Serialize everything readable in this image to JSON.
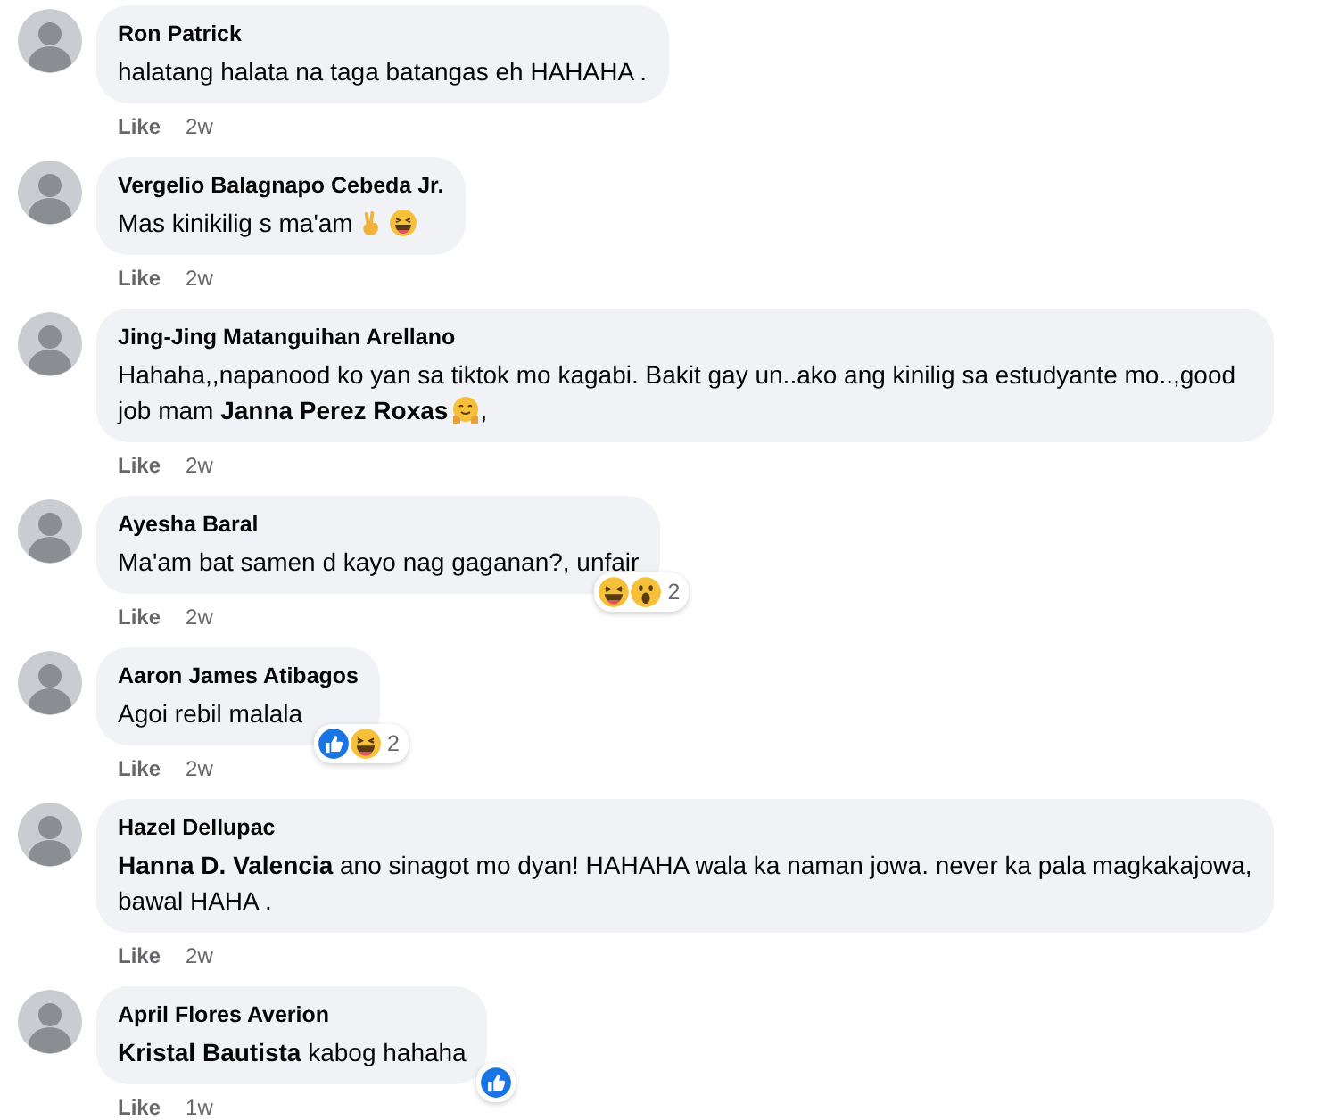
{
  "comments": [
    {
      "author": "Ron Patrick",
      "body": [
        {
          "kind": "text",
          "text": "halatang halata na taga batangas eh HAHAHA ."
        }
      ],
      "like": "Like",
      "time": "2w"
    },
    {
      "author": "Vergelio Balagnapo Cebeda Jr.",
      "body": [
        {
          "kind": "text",
          "text": "Mas kinikilig s ma'am"
        },
        {
          "kind": "peace"
        },
        {
          "kind": "laugh"
        }
      ],
      "like": "Like",
      "time": "2w"
    },
    {
      "author": "Jing-Jing Matanguihan Arellano",
      "body": [
        {
          "kind": "text",
          "text": "Hahaha,,napanood ko yan sa tiktok mo kagabi. Bakit gay un..ako ang kinilig sa estudyante mo..,good job mam "
        },
        {
          "kind": "mention",
          "text": "Janna Perez Roxas"
        },
        {
          "kind": "hug"
        },
        {
          "kind": "text",
          "text": ","
        }
      ],
      "like": "Like",
      "time": "2w"
    },
    {
      "author": "Ayesha Baral",
      "body": [
        {
          "kind": "text",
          "text": "Ma'am bat samen d kayo nag gaganan?, unfair"
        }
      ],
      "like": "Like",
      "time": "2w",
      "reactions": {
        "types": [
          {
            "kind": "haha"
          },
          {
            "kind": "wow"
          }
        ],
        "count": "2"
      }
    },
    {
      "author": "Aaron James Atibagos",
      "body": [
        {
          "kind": "text",
          "text": "Agoi rebil malala"
        }
      ],
      "like": "Like",
      "time": "2w",
      "reactions": {
        "types": [
          {
            "kind": "like"
          },
          {
            "kind": "haha"
          }
        ],
        "count": "2"
      }
    },
    {
      "author": "Hazel Dellupac",
      "body": [
        {
          "kind": "mention",
          "text": "Hanna D. Valencia"
        },
        {
          "kind": "text",
          "text": " ano sinagot mo dyan! HAHAHA wala ka naman jowa. never ka pala magkakajowa, bawal HAHA ."
        }
      ],
      "like": "Like",
      "time": "2w"
    },
    {
      "author": "April Flores Averion",
      "body": [
        {
          "kind": "mention",
          "text": "Kristal Bautista"
        },
        {
          "kind": "text",
          "text": " kabog hahaha"
        }
      ],
      "like": "Like",
      "time": "1w",
      "reactions": {
        "types": [
          {
            "kind": "like"
          }
        ]
      }
    }
  ]
}
